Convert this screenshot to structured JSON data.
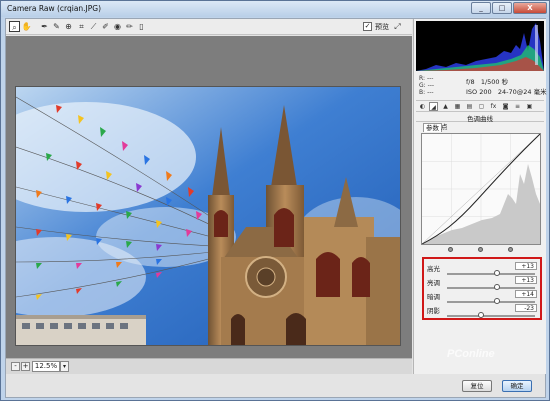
{
  "window": {
    "title": "Camera Raw (crqian.JPG)",
    "minimize_label": "_",
    "maximize_label": "□",
    "close_label": "X"
  },
  "toolbar": {
    "tools": [
      "zoom-tool",
      "hand-tool",
      "white-balance-tool",
      "color-sampler-tool",
      "targeted-adjustment-tool",
      "crop-tool",
      "straighten-tool",
      "spot-removal-tool",
      "red-eye-tool",
      "brush-tool",
      "gradient-tool"
    ],
    "preview_label": "预览",
    "preview_checked": true
  },
  "statusbar": {
    "zoom_minus": "-",
    "zoom_plus": "+",
    "zoom_value": "12.5%",
    "zoom_dropdown": "▾"
  },
  "info": {
    "r_label": "R:",
    "g_label": "G:",
    "b_label": "B:",
    "r_value": "---",
    "g_value": "---",
    "b_value": "---",
    "aperture": "f/8",
    "shutter": "1/500 秒",
    "iso": "ISO 200",
    "lens": "24-70@24 毫米"
  },
  "panel": {
    "title": "色调曲线",
    "subtab_parametric": "参数",
    "subtab_point": "点"
  },
  "sliders": [
    {
      "label": "高光",
      "value": "+13",
      "position": 0.57
    },
    {
      "label": "亮调",
      "value": "+13",
      "position": 0.57
    },
    {
      "label": "暗调",
      "value": "+14",
      "position": 0.57
    },
    {
      "label": "阴影",
      "value": "-23",
      "position": 0.38
    }
  ],
  "buttons": {
    "reset": "复位",
    "ok": "确定"
  },
  "watermark": "PConline",
  "colors": {
    "slider_highlight_border": "#d01818",
    "sky_blue": "#3a78d0"
  }
}
